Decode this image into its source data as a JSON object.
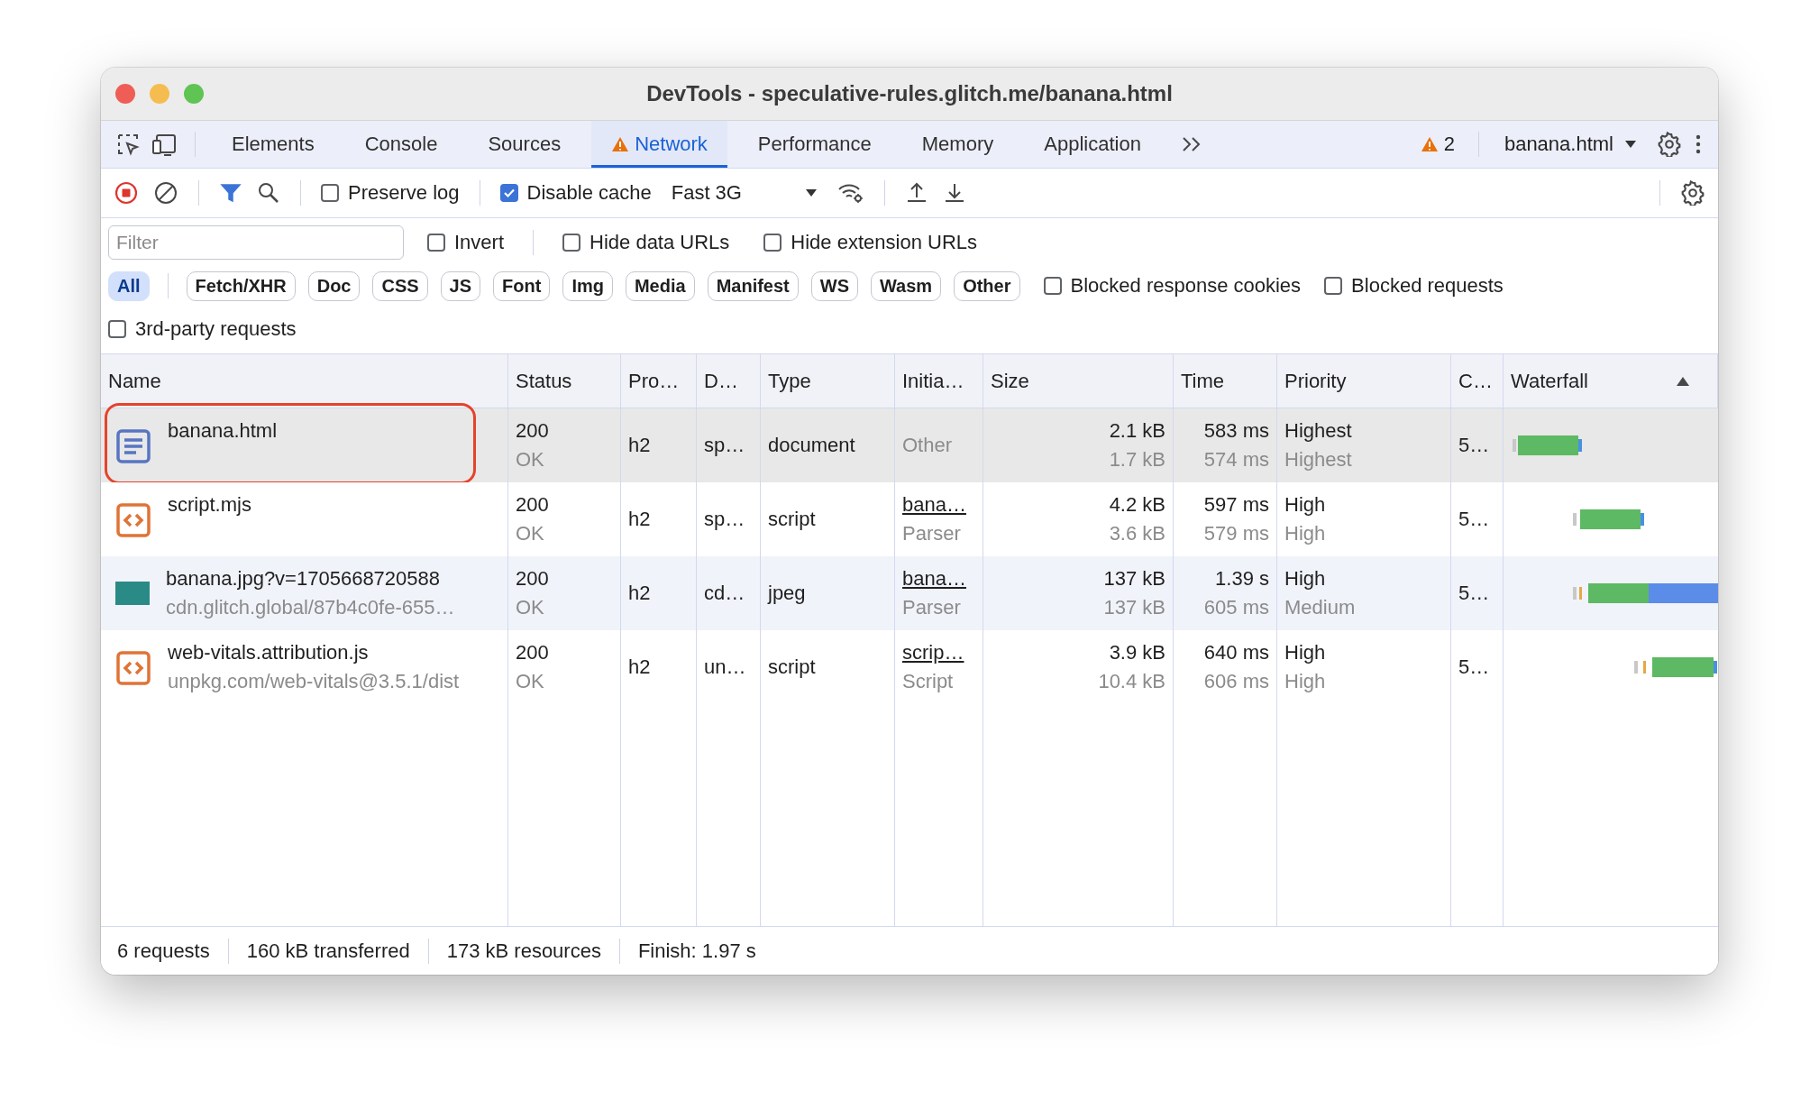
{
  "window": {
    "title": "DevTools - speculative-rules.glitch.me/banana.html"
  },
  "tabs": [
    {
      "label": "Elements",
      "selected": false,
      "warning": false
    },
    {
      "label": "Console",
      "selected": false,
      "warning": false
    },
    {
      "label": "Sources",
      "selected": false,
      "warning": false
    },
    {
      "label": "Network",
      "selected": true,
      "warning": true
    },
    {
      "label": "Performance",
      "selected": false,
      "warning": false
    },
    {
      "label": "Memory",
      "selected": false,
      "warning": false
    },
    {
      "label": "Application",
      "selected": false,
      "warning": false
    }
  ],
  "warning_count": "2",
  "context": "banana.html",
  "toolbar": {
    "recording": true,
    "filter_active": true,
    "preserve_log": {
      "label": "Preserve log",
      "checked": false
    },
    "disable_cache": {
      "label": "Disable cache",
      "checked": true
    },
    "throttling": "Fast 3G"
  },
  "filter": {
    "placeholder": "Filter",
    "options": [
      {
        "label": "Invert",
        "checked": false
      },
      {
        "label": "Hide data URLs",
        "checked": false
      },
      {
        "label": "Hide extension URLs",
        "checked": false
      }
    ]
  },
  "type_filters": [
    {
      "label": "All",
      "selected": true
    },
    {
      "label": "Fetch/XHR",
      "selected": false
    },
    {
      "label": "Doc",
      "selected": false
    },
    {
      "label": "CSS",
      "selected": false
    },
    {
      "label": "JS",
      "selected": false
    },
    {
      "label": "Font",
      "selected": false
    },
    {
      "label": "Img",
      "selected": false
    },
    {
      "label": "Media",
      "selected": false
    },
    {
      "label": "Manifest",
      "selected": false
    },
    {
      "label": "WS",
      "selected": false
    },
    {
      "label": "Wasm",
      "selected": false
    },
    {
      "label": "Other",
      "selected": false
    }
  ],
  "type_options": [
    {
      "label": "Blocked response cookies",
      "checked": false
    },
    {
      "label": "Blocked requests",
      "checked": false
    }
  ],
  "third_party": {
    "label": "3rd-party requests",
    "checked": false
  },
  "table": {
    "columns": [
      {
        "label": "Name"
      },
      {
        "label": "Status"
      },
      {
        "label": "Pro…"
      },
      {
        "label": "D…"
      },
      {
        "label": "Type"
      },
      {
        "label": "Initia…"
      },
      {
        "label": "Size"
      },
      {
        "label": "Time"
      },
      {
        "label": "Priority"
      },
      {
        "label": "C…"
      },
      {
        "label": "Waterfall",
        "sort_ascending": true
      }
    ],
    "rows": [
      {
        "kind": "document",
        "name": "banana.html",
        "highlighted": true,
        "selected": true,
        "status": "200",
        "status_text": "OK",
        "protocol": "h2",
        "domain": "sp…",
        "type": "document",
        "initiator": {
          "text": "Other",
          "link": false
        },
        "size": "2.1 kB",
        "resource_size": "1.7 kB",
        "time": "583 ms",
        "latency": "574 ms",
        "priority": "Highest",
        "initial_priority": "Highest",
        "column_10": "5…"
      },
      {
        "kind": "script",
        "name": "script.mjs",
        "highlighted": false,
        "selected": false,
        "status": "200",
        "status_text": "OK",
        "protocol": "h2",
        "domain": "sp…",
        "type": "script",
        "initiator": {
          "text": "bana…",
          "link": true
        },
        "initiator_detail": "Parser",
        "size": "4.2 kB",
        "resource_size": "3.6 kB",
        "time": "597 ms",
        "latency": "579 ms",
        "priority": "High",
        "initial_priority": "High",
        "column_10": "5…"
      },
      {
        "kind": "image",
        "name": "banana.jpg?v=1705668720588",
        "path": "cdn.glitch.global/87b4c0fe-655…",
        "highlighted": false,
        "selected": false,
        "status": "200",
        "status_text": "OK",
        "protocol": "h2",
        "domain": "cd…",
        "type": "jpeg",
        "initiator": {
          "text": "bana…",
          "link": true
        },
        "initiator_detail": "Parser",
        "size": "137 kB",
        "resource_size": "137 kB",
        "time": "1.39 s",
        "latency": "605 ms",
        "priority": "High",
        "initial_priority": "Medium",
        "column_10": "5…"
      },
      {
        "kind": "script",
        "name": "web-vitals.attribution.js",
        "path": "unpkg.com/web-vitals@3.5.1/dist",
        "highlighted": false,
        "selected": false,
        "status": "200",
        "status_text": "OK",
        "protocol": "h2",
        "domain": "un…",
        "type": "script",
        "initiator": {
          "text": "scrip…",
          "link": true
        },
        "initiator_detail": "Script",
        "size": "3.9 kB",
        "resource_size": "10.4 kB",
        "time": "640 ms",
        "latency": "606 ms",
        "priority": "High",
        "initial_priority": "High",
        "column_10": "5…"
      }
    ]
  },
  "status_bar": [
    "6 requests",
    "160 kB transferred",
    "173 kB resources",
    "Finish: 1.97 s"
  ]
}
